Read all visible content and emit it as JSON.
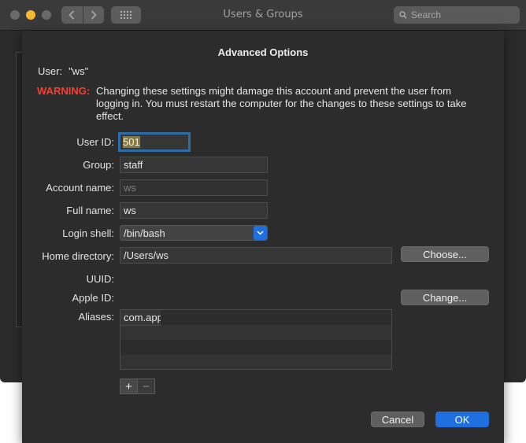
{
  "window": {
    "title": "Users & Groups",
    "search_placeholder": "Search"
  },
  "sheet": {
    "title": "Advanced Options",
    "user_label": "User:",
    "user_value": "\"ws\"",
    "warning_label": "WARNING:",
    "warning_text": "Changing these settings might damage this account and prevent the user from logging in. You must restart the computer for the changes to these settings to take effect.",
    "fields": {
      "user_id": {
        "label": "User ID:",
        "value": "501"
      },
      "group": {
        "label": "Group:",
        "value": "staff"
      },
      "account_name": {
        "label": "Account name:",
        "value": "ws"
      },
      "full_name": {
        "label": "Full name:",
        "value": "ws"
      },
      "login_shell": {
        "label": "Login shell:",
        "value": "/bin/bash"
      },
      "home_directory": {
        "label": "Home directory:",
        "value": "/Users/ws"
      },
      "uuid": {
        "label": "UUID:",
        "value": ""
      },
      "apple_id": {
        "label": "Apple ID:",
        "value": ""
      },
      "aliases": {
        "label": "Aliases:",
        "value": "com.apple"
      }
    },
    "buttons": {
      "choose": "Choose...",
      "change": "Change...",
      "add": "+",
      "remove": "−",
      "cancel": "Cancel",
      "ok": "OK"
    }
  }
}
